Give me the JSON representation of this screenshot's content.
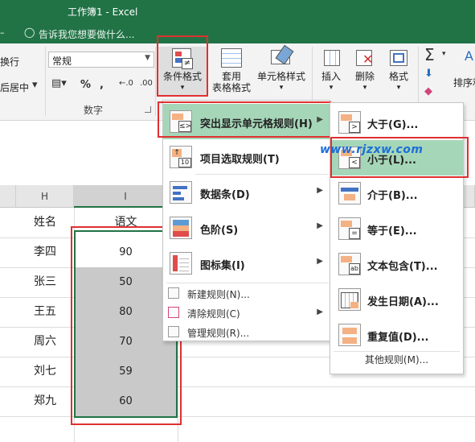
{
  "title_bar": {
    "title": "工作簿1 - Excel"
  },
  "tell_me": {
    "placeholder": "告诉我您想要做什么..."
  },
  "ribbon": {
    "left_partial_1": "换行",
    "left_partial_2": "后居中",
    "number_format": "常规",
    "number_group_label": "数字",
    "cond_format_label": "条件格式",
    "table_format_label_1": "套用",
    "table_format_label_2": "表格格式",
    "cell_style_label": "单元格样式",
    "insert_label": "插入",
    "delete_label": "删除",
    "format_label": "格式",
    "sort_partial": "排序和"
  },
  "sheet": {
    "columns": [
      "H",
      "I"
    ],
    "header_row": {
      "name": "姓名",
      "score": "语文"
    },
    "rows": [
      {
        "name": "李四",
        "score": "90"
      },
      {
        "name": "张三",
        "score": "50"
      },
      {
        "name": "王五",
        "score": "80"
      },
      {
        "name": "周六",
        "score": "70"
      },
      {
        "name": "刘七",
        "score": "59"
      },
      {
        "name": "郑九",
        "score": "60"
      }
    ]
  },
  "cf_menu": {
    "items": [
      {
        "label": "突出显示单元格规则(H)",
        "highlighted": true
      },
      {
        "label": "项目选取规则(T)"
      },
      {
        "label": "数据条(D)"
      },
      {
        "label": "色阶(S)"
      },
      {
        "label": "图标集(I)"
      }
    ],
    "small_items": [
      {
        "label": "新建规则(N)..."
      },
      {
        "label": "清除规则(C)"
      },
      {
        "label": "管理规则(R)..."
      }
    ]
  },
  "highlight_submenu": {
    "items": [
      {
        "label": "大于(G)..."
      },
      {
        "label": "小于(L)...",
        "highlighted": true
      },
      {
        "label": "介于(B)..."
      },
      {
        "label": "等于(E)..."
      },
      {
        "label": "文本包含(T)..."
      },
      {
        "label": "发生日期(A)..."
      },
      {
        "label": "重复值(D)..."
      }
    ],
    "other_rules": "其他规则(M)..."
  },
  "watermark": "www.rjzxw.com",
  "colors": {
    "excel_green": "#217346",
    "highlight": "#a6d6b8",
    "annotation_red": "#e03030",
    "selection_fill": "#c9c9c9"
  }
}
